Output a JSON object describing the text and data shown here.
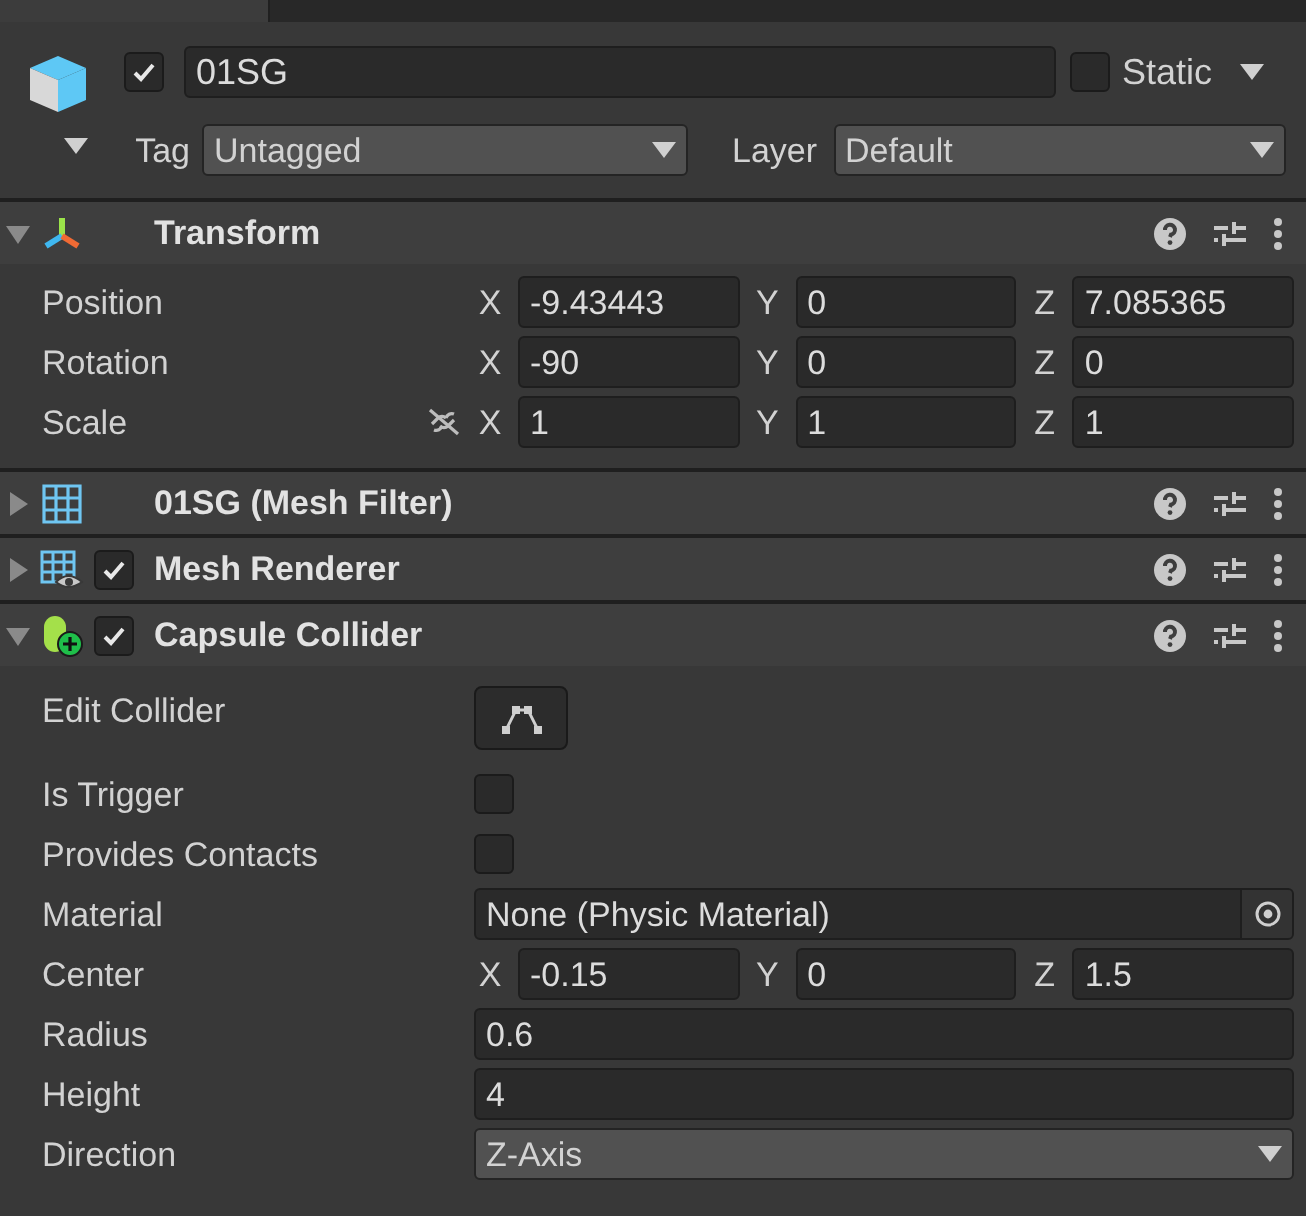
{
  "object": {
    "active": true,
    "name": "01SG",
    "static": false,
    "static_label": "Static",
    "tag": {
      "label": "Tag",
      "value": "Untagged"
    },
    "layer": {
      "label": "Layer",
      "value": "Default"
    }
  },
  "components": [
    {
      "title": "Transform",
      "kind": "transform",
      "expanded": true,
      "properties": [
        {
          "kind": "vector",
          "label": "Position",
          "fields": [
            {
              "axis": "X",
              "value": "-9.43443"
            },
            {
              "axis": "Y",
              "value": "0"
            },
            {
              "axis": "Z",
              "value": "7.085365"
            }
          ]
        },
        {
          "kind": "vector",
          "label": "Rotation",
          "fields": [
            {
              "axis": "X",
              "value": "-90"
            },
            {
              "axis": "Y",
              "value": "0"
            },
            {
              "axis": "Z",
              "value": "0"
            }
          ]
        },
        {
          "kind": "vector",
          "label": "Scale",
          "constrain_toggle": true,
          "fields": [
            {
              "axis": "X",
              "value": "1"
            },
            {
              "axis": "Y",
              "value": "1"
            },
            {
              "axis": "Z",
              "value": "1"
            }
          ]
        }
      ]
    },
    {
      "title": "01SG (Mesh Filter)",
      "kind": "mesh-filter",
      "expanded": false
    },
    {
      "title": "Mesh Renderer",
      "kind": "mesh-renderer",
      "expanded": false,
      "enabled": true
    },
    {
      "title": "Capsule Collider",
      "kind": "capsule-collider",
      "expanded": true,
      "enabled": true,
      "properties": [
        {
          "kind": "edit-button",
          "label": "Edit Collider"
        },
        {
          "kind": "checkbox",
          "label": "Is Trigger",
          "checked": false
        },
        {
          "kind": "checkbox",
          "label": "Provides Contacts",
          "checked": false
        },
        {
          "kind": "object",
          "label": "Material",
          "value": "None (Physic Material)"
        },
        {
          "kind": "vector",
          "label": "Center",
          "fields": [
            {
              "axis": "X",
              "value": "-0.15"
            },
            {
              "axis": "Y",
              "value": "0"
            },
            {
              "axis": "Z",
              "value": "1.5"
            }
          ]
        },
        {
          "kind": "text",
          "label": "Radius",
          "value": "0.6"
        },
        {
          "kind": "text",
          "label": "Height",
          "value": "4"
        },
        {
          "kind": "dropdown",
          "label": "Direction",
          "value": "Z-Axis"
        }
      ]
    }
  ]
}
